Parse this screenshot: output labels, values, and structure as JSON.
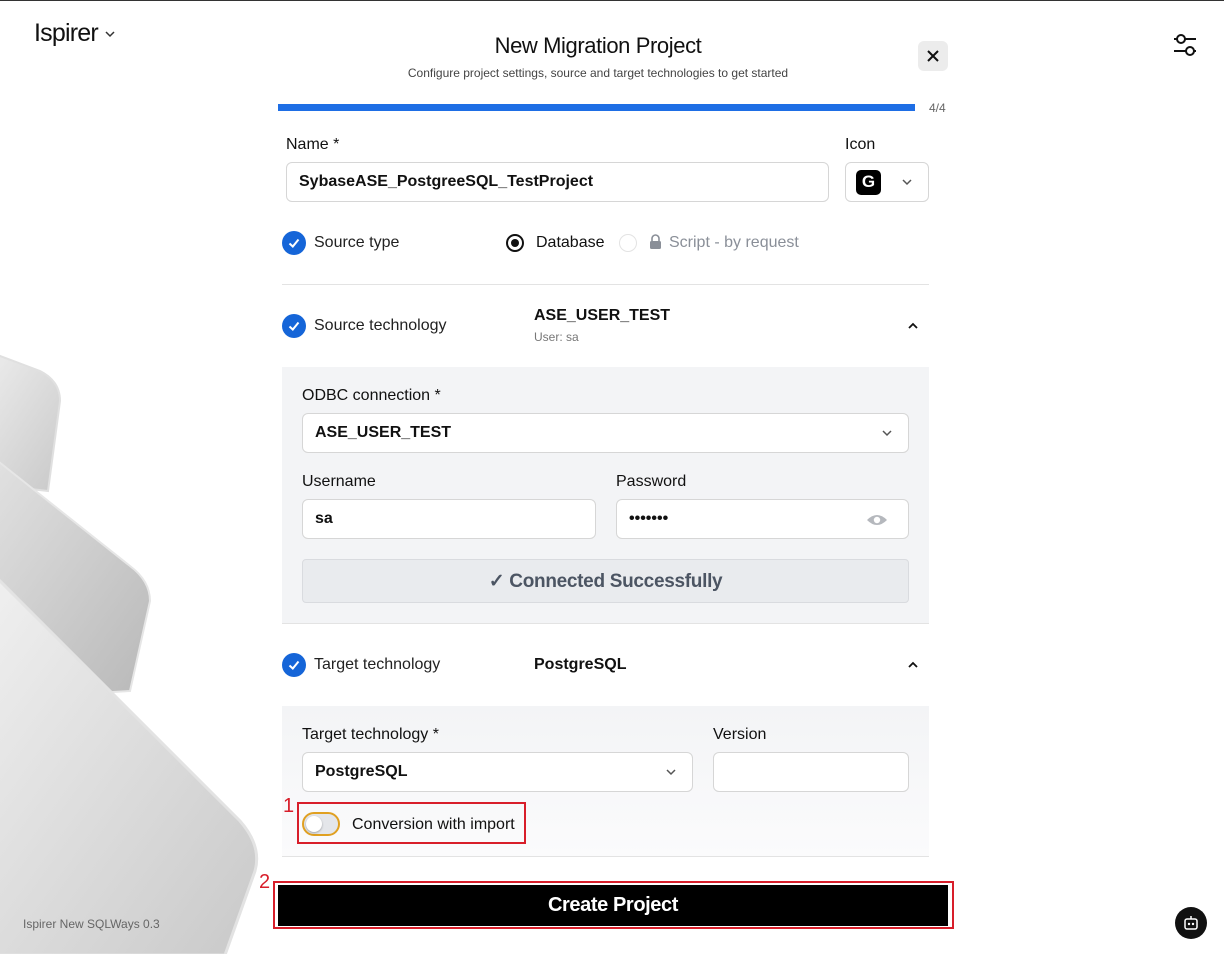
{
  "brand": {
    "name": "Ispirer"
  },
  "footer": {
    "version": "Ispirer New SQLWays 0.3"
  },
  "header": {
    "title": "New Migration Project",
    "subtitle": "Configure project settings, source and target technologies to get started"
  },
  "progress": {
    "label": "4/4",
    "fraction": 1.0
  },
  "form": {
    "name_label": "Name *",
    "name_value": "SybaseASE_PostgreeSQL_TestProject",
    "icon_label": "Icon",
    "icon_letter": "G"
  },
  "source_type": {
    "title": "Source type",
    "option_database": "Database",
    "option_script": "Script - by request",
    "selected": "Database"
  },
  "source_tech": {
    "title": "Source technology",
    "value": "ASE_USER_TEST",
    "subvalue": "User: sa",
    "odbc_label": "ODBC connection *",
    "odbc_value": "ASE_USER_TEST",
    "username_label": "Username",
    "username_value": "sa",
    "password_label": "Password",
    "password_value": "•••••••",
    "status_button": "✓ Connected Successfully"
  },
  "target_tech": {
    "title": "Target technology",
    "value": "PostgreSQL",
    "select_label": "Target technology *",
    "select_value": "PostgreSQL",
    "version_label": "Version",
    "version_value": "",
    "toggle_label": "Conversion with import",
    "toggle_on": false
  },
  "annotations": {
    "marker_1": "1",
    "marker_2": "2"
  },
  "actions": {
    "create_label": "Create Project"
  },
  "colors": {
    "accent": "#1e6ee5",
    "check": "#1565d8",
    "annotation": "#d81e2a",
    "toggle_border": "#e0a021"
  }
}
